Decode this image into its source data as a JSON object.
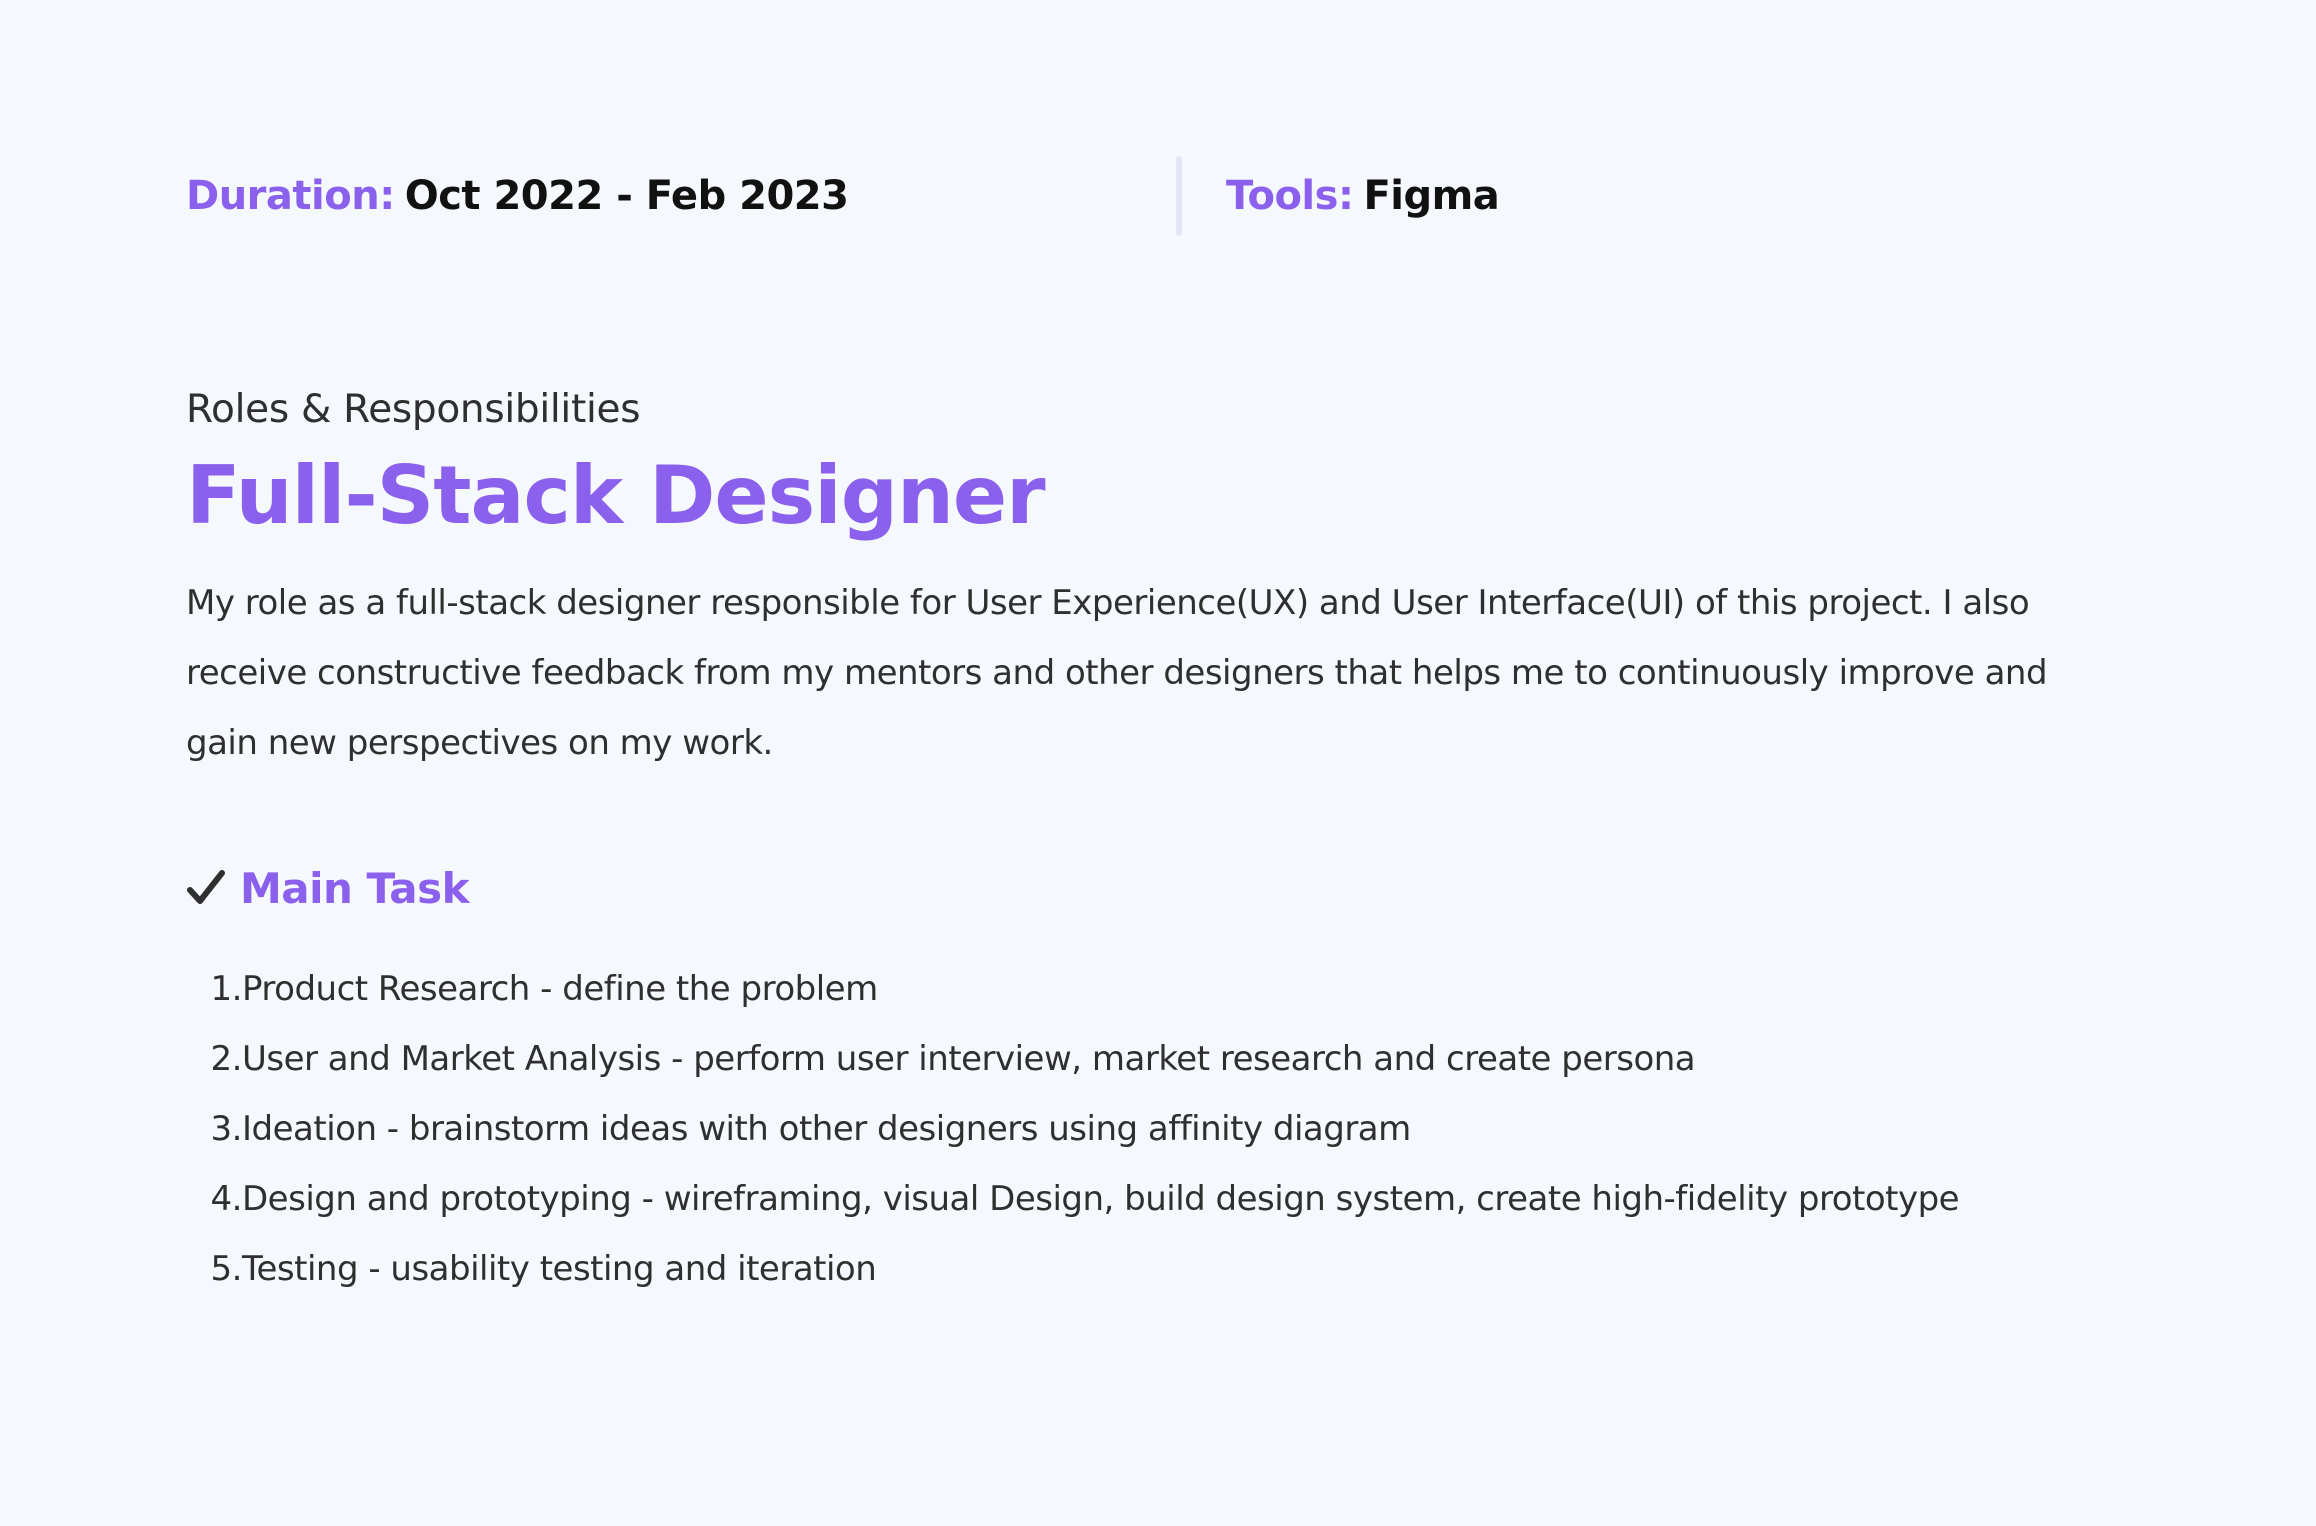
{
  "meta": {
    "duration_label": "Duration:",
    "duration_value": "Oct 2022 - Feb 2023",
    "tools_label": "Tools:",
    "tools_value": "Figma"
  },
  "section": {
    "eyebrow": "Roles & Responsibilities",
    "title": "Full-Stack Designer",
    "description": "My role as a full-stack designer responsible for User Experience(UX) and User Interface(UI) of this project. I also receive constructive feedback from my mentors and other designers that helps me to continuously improve and gain new perspectives on my work."
  },
  "main_task": {
    "icon": "check-icon",
    "heading": "Main Task",
    "items": [
      {
        "number": "1.",
        "text": "Product Research - define the problem"
      },
      {
        "number": "2.",
        "text": "User and Market Analysis - perform user interview, market research and create persona"
      },
      {
        "number": "3.",
        "text": "Ideation -  brainstorm ideas with other designers using affinity diagram"
      },
      {
        "number": "4.",
        "text": "Design and prototyping - wireframing, visual Design, build design system, create high-fidelity prototype"
      },
      {
        "number": "5.",
        "text": "Testing - usability testing and iteration"
      }
    ]
  },
  "colors": {
    "accent": "#8b60ec",
    "text": "#2f2f2f",
    "background": "#f5f9fe",
    "divider": "#e3e5f8"
  }
}
